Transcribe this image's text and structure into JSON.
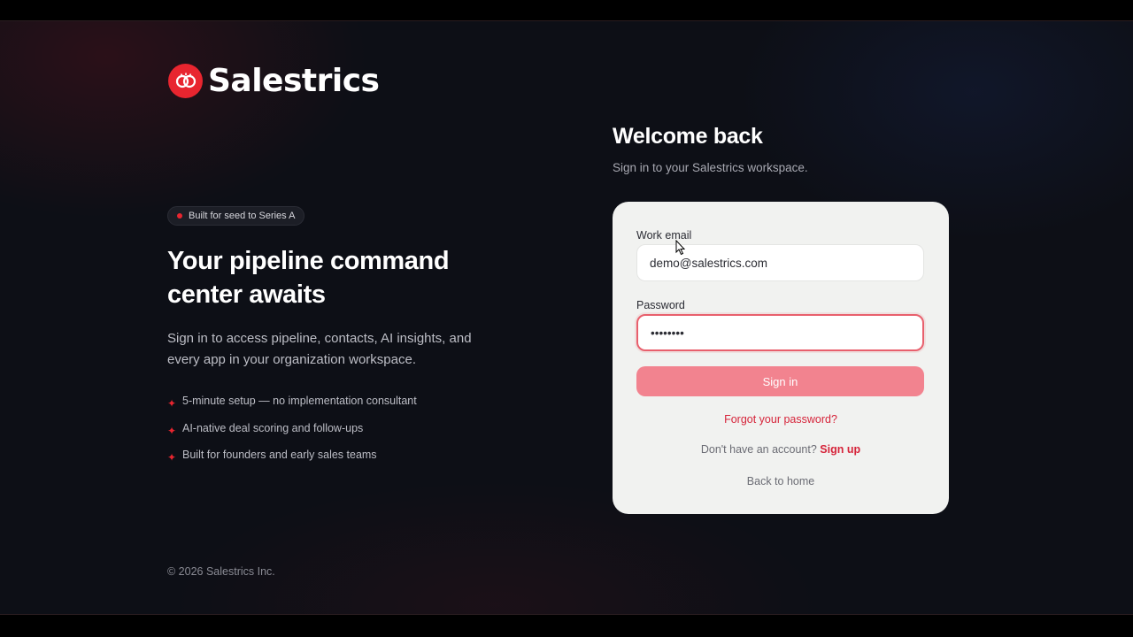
{
  "brand": {
    "name": "Salestrics",
    "logo_icon": "linked-rings-icon",
    "accent_color": "#e8252f"
  },
  "hero": {
    "badge": "Built for seed to Series A",
    "headline_line1": "Your pipeline command",
    "headline_line2": "center awaits",
    "subtext": "Sign in to access pipeline, contacts, AI insights, and every app in your organization workspace.",
    "features": [
      "5-minute setup — no implementation consultant",
      "AI-native deal scoring and follow-ups",
      "Built for founders and early sales teams"
    ],
    "feature_icon": "sparkle-icon"
  },
  "footer": {
    "copyright": "© 2026 Salestrics Inc."
  },
  "login": {
    "title": "Welcome back",
    "subtitle": "Sign in to your Salestrics workspace.",
    "email_label": "Work email",
    "email_value": "demo@salestrics.com",
    "password_label": "Password",
    "password_value": "password",
    "signin_label": "Sign in",
    "forgot_label": "Forgot your password?",
    "no_account_text": "Don't have an account?",
    "signup_label": "Sign up",
    "back_home_label": "Back to home",
    "button_color": "#f2838f",
    "link_color": "#d6243a"
  }
}
